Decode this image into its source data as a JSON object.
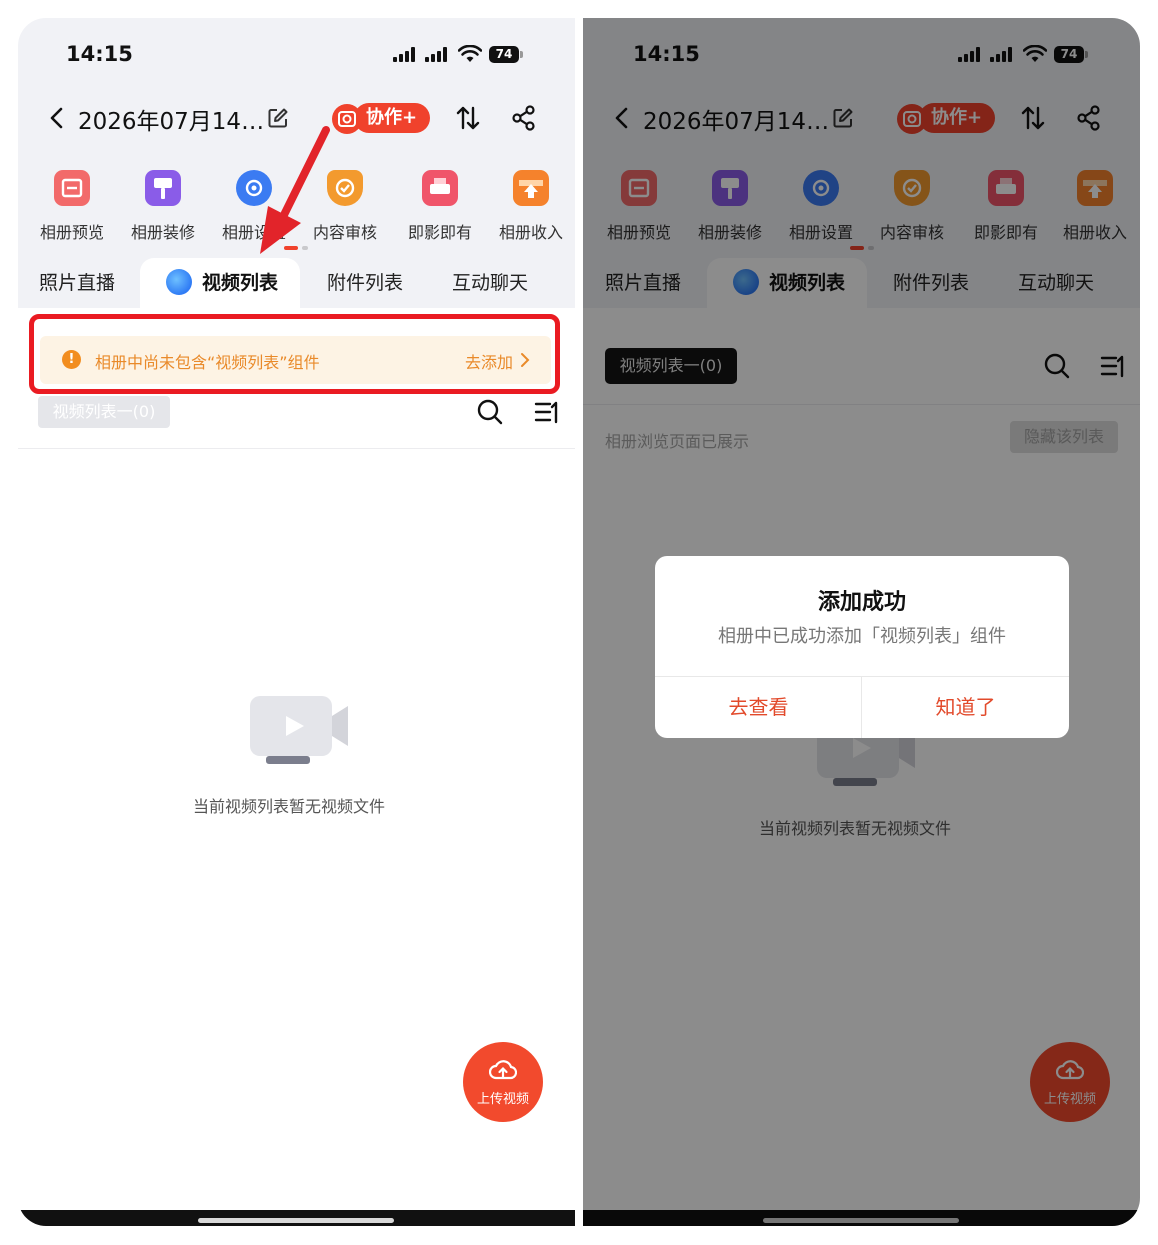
{
  "status_bar": {
    "time": "14:15",
    "battery": "74"
  },
  "header": {
    "title": "2026年07月14…",
    "collab_label": "协作+"
  },
  "tools": [
    {
      "label": "相册预览",
      "icon": "album-preview-icon",
      "color": "#f05a5a"
    },
    {
      "label": "相册装修",
      "icon": "album-decor-icon",
      "color": "#8a5ce8"
    },
    {
      "label": "相册设置",
      "icon": "album-settings-icon",
      "color": "#3b7bf2"
    },
    {
      "label": "内容审核",
      "icon": "content-review-icon",
      "color": "#f39a2e"
    },
    {
      "label": "即影即有",
      "icon": "instant-print-icon",
      "color": "#f0556a"
    },
    {
      "label": "相册收入",
      "icon": "album-income-icon",
      "color": "#f5822c"
    }
  ],
  "tabs": [
    {
      "label": "照片直播"
    },
    {
      "label": "视频列表",
      "active": true
    },
    {
      "label": "附件列表"
    },
    {
      "label": "互动聊天"
    }
  ],
  "left": {
    "notice": {
      "text": "相册中尚未包含“视频列表”组件",
      "action": "去添加"
    },
    "list_chip": "视频列表一(0)",
    "empty_text": "当前视频列表暂无视频文件",
    "fab_label": "上传视频"
  },
  "right": {
    "list_chip": "视频列表一(0)",
    "status_note": "相册浏览页面已展示",
    "hide_button": "隐藏该列表",
    "empty_text": "当前视频列表暂无视频文件",
    "fab_label": "上传视频",
    "dialog": {
      "title": "添加成功",
      "message": "相册中已成功添加「视频列表」组件",
      "view_button": "去查看",
      "ok_button": "知道了"
    }
  },
  "colors": {
    "accent": "#f0422c",
    "notice_text": "#e98a2a",
    "notice_bg": "#fdf3e4",
    "highlight": "#ea1b22"
  }
}
